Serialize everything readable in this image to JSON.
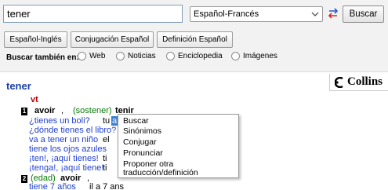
{
  "search": {
    "query": "tener",
    "language": "Español-Francés",
    "button_label": "Buscar"
  },
  "tools": {
    "items": [
      "Español-Inglés",
      "Conjugación Español",
      "Definición Español"
    ]
  },
  "also_search": {
    "label": "Buscar también en:",
    "options": [
      "Web",
      "Noticias",
      "Enciclopedia",
      "Imágenes"
    ]
  },
  "publisher": "Collins",
  "entry": {
    "headword": "tener",
    "pos": "vt",
    "sense1": {
      "num": "1",
      "translation": "avoir",
      "comma": ",",
      "gloss": "(sostener)",
      "translation2": "tenir",
      "examples": [
        {
          "es": "¿tienes un boli?",
          "fr": "tu"
        },
        {
          "es": "¿dónde tienes el libro?",
          "fr": ""
        },
        {
          "es": "va a tener un niño",
          "fr": "el"
        },
        {
          "es": "tiene los ojos azules",
          "fr": ""
        },
        {
          "es": "¡ten!, ¡aquí tienes!",
          "fr": "ti"
        },
        {
          "es": "¡tenga!, ¡aquí tiene!",
          "fr": "ti"
        }
      ]
    },
    "sense2": {
      "num": "2",
      "gloss": "(edad)",
      "translation": "avoir",
      "comma": ",",
      "example_es": "tiene 7 años",
      "example_fr": "il a 7 ans"
    }
  },
  "context_menu": {
    "items": [
      "Buscar",
      "Sinónimos",
      "Conjugar",
      "Pronunciar",
      "Proponer otra",
      "traducción/definición"
    ]
  },
  "colors": {
    "headword": "#1a3fa8",
    "pos": "#c00000",
    "gloss": "#0a7a0a",
    "example": "#1f3fd0",
    "selection": "#3c7fd1"
  }
}
